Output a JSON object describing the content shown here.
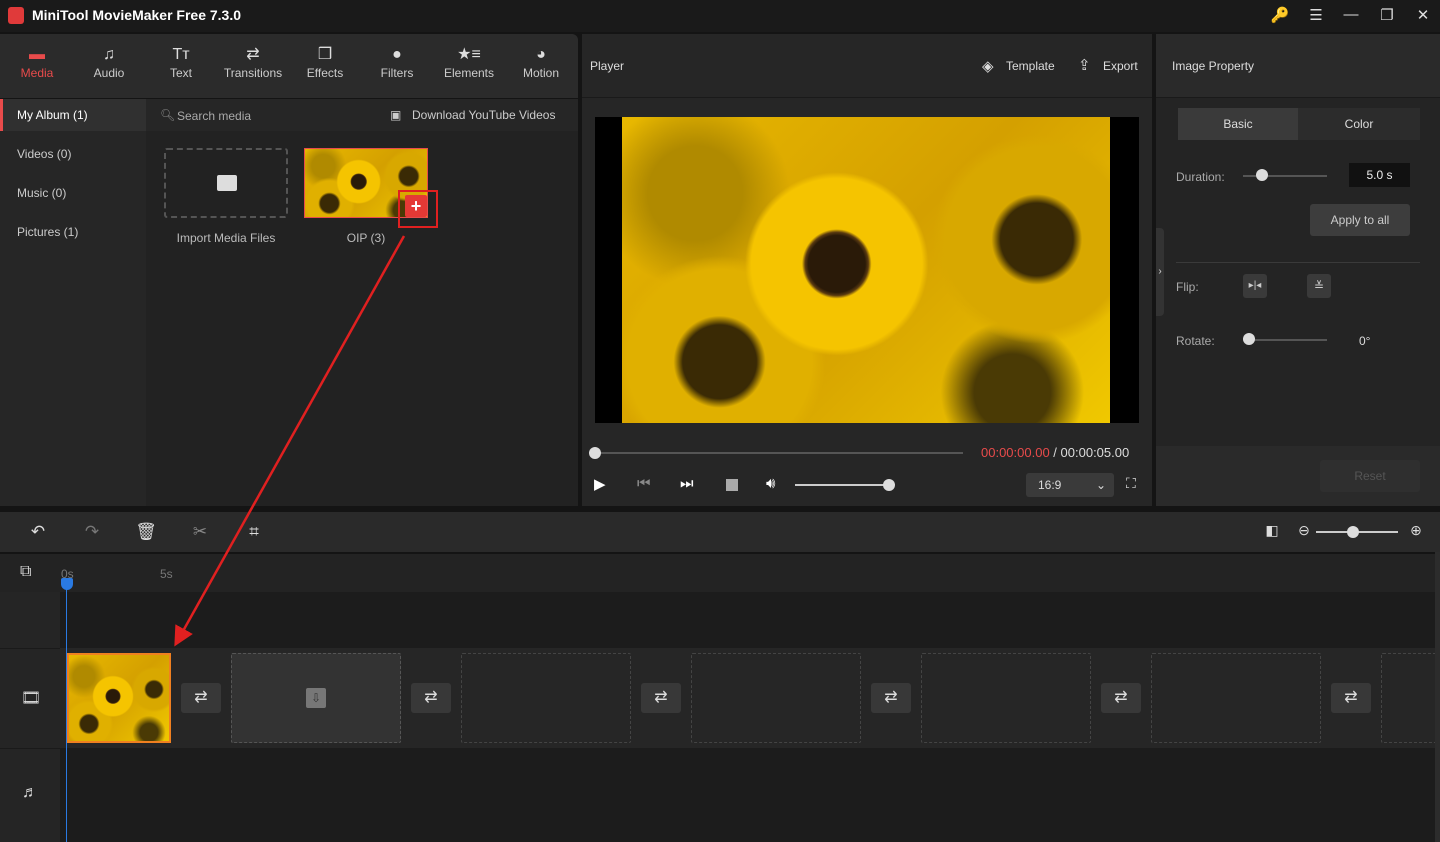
{
  "app": {
    "title": "MiniTool MovieMaker Free 7.3.0",
    "window_controls": [
      "key-icon",
      "menu-icon",
      "minimize-icon",
      "maximize-icon",
      "close-icon"
    ]
  },
  "toolbar": {
    "items": [
      {
        "label": "Media",
        "icon": "folder-icon",
        "active": true
      },
      {
        "label": "Audio",
        "icon": "music-icon"
      },
      {
        "label": "Text",
        "icon": "text-icon"
      },
      {
        "label": "Transitions",
        "icon": "transition-icon"
      },
      {
        "label": "Effects",
        "icon": "effects-icon"
      },
      {
        "label": "Filters",
        "icon": "filters-icon"
      },
      {
        "label": "Elements",
        "icon": "elements-icon"
      },
      {
        "label": "Motion",
        "icon": "motion-icon"
      }
    ]
  },
  "sidebar": {
    "items": [
      {
        "label": "My Album (1)",
        "active": true
      },
      {
        "label": "Videos (0)"
      },
      {
        "label": "Music (0)"
      },
      {
        "label": "Pictures (1)"
      }
    ]
  },
  "media": {
    "search_placeholder": "Search media",
    "download_label": "Download YouTube Videos",
    "import_label": "Import Media Files",
    "file_label": "OIP (3)"
  },
  "player": {
    "title": "Player",
    "template_label": "Template",
    "export_label": "Export",
    "current_time": "00:00:00.00",
    "separator": " / ",
    "total_time": "00:00:05.00",
    "aspect_ratio": "16:9",
    "progress": 0,
    "volume": 0.92
  },
  "property": {
    "title": "Image Property",
    "tabs": [
      "Basic",
      "Color"
    ],
    "active_tab": "Basic",
    "duration_label": "Duration:",
    "duration_value": "5.0 s",
    "apply_label": "Apply to all",
    "flip_label": "Flip:",
    "rotate_label": "Rotate:",
    "rotate_value": "0°",
    "reset_label": "Reset"
  },
  "timeline": {
    "ruler_labels": [
      "0s",
      "5s"
    ],
    "zoom_level": 0.6
  },
  "colors": {
    "accent": "#e84b4b",
    "playhead": "#2a7ae2",
    "highlight": "#e02020"
  }
}
